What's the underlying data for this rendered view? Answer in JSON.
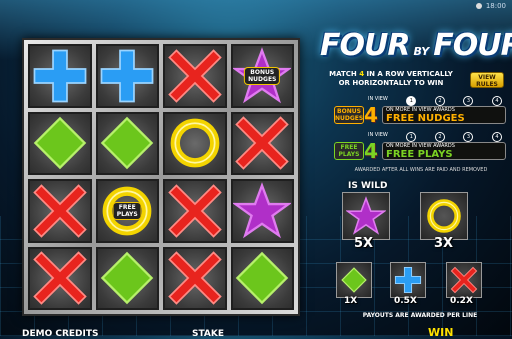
{
  "system": {
    "time": "18:00"
  },
  "board": {
    "cells": [
      [
        "plus",
        "plus",
        "x",
        "star-bonus"
      ],
      [
        "diamond",
        "diamond",
        "ring",
        "x"
      ],
      [
        "x",
        "ring-free",
        "x",
        "star"
      ],
      [
        "x",
        "diamond",
        "x",
        "diamond"
      ]
    ],
    "tags": {
      "bonus": "BONUS\nNUDGES",
      "free": "FREE\nPLAYS"
    }
  },
  "logo": {
    "word1": "FOUR",
    "by": "BY",
    "word2": "FOUR"
  },
  "rules": {
    "line1_pre": "MATCH ",
    "line1_num": "4",
    "line1_post": " IN A ROW VERTICALLY",
    "line2": "OR HORIZONTALLY TO WIN",
    "view_rules": "VIEW RULES"
  },
  "features": [
    {
      "icon_text": "BONUS\nNUDGES",
      "count": "4",
      "small": "ON MORE IN VIEW AWARDS",
      "award": "FREE NUDGES",
      "numbers": [
        "IN VIEW",
        "1",
        "2",
        "3",
        "4"
      ],
      "color": "#ffb000"
    },
    {
      "icon_text": "FREE\nPLAYS",
      "count": "4",
      "small": "ON MORE IN VIEW AWARDS",
      "award": "FREE PLAYS",
      "numbers": [
        "IN VIEW",
        "1",
        "2",
        "3",
        "4"
      ],
      "color": "#7bd323"
    }
  ],
  "awarded_note": "AWARDED AFTER ALL WINS ARE PAID AND REMOVED",
  "paytable": {
    "wild_title": "IS WILD",
    "star": "5X",
    "ring": "3X",
    "diamond": "1X",
    "plus": "0.5X",
    "x": "0.2X",
    "note": "PAYOUTS ARE AWARDED PER LINE"
  },
  "bottom": {
    "credits": "DEMO CREDITS",
    "stake": "STAKE",
    "win": "WIN"
  },
  "colors": {
    "plus": "#2a9df4",
    "x": "#e8241e",
    "star": "#b02fc8",
    "diamond": "#6cc61c",
    "ring": "#f3d400",
    "accent": "#ffb000"
  }
}
